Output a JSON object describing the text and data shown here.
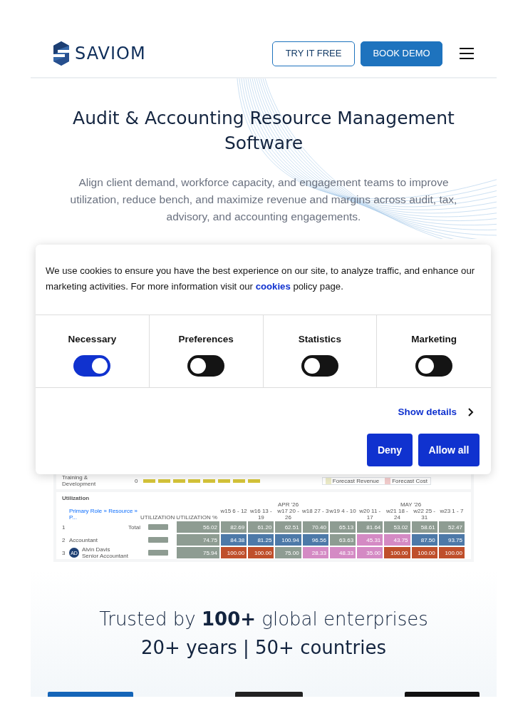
{
  "header": {
    "logo": "SAVIOM",
    "buttons": [
      {
        "label": "TRY IT FREE",
        "kind": "outline"
      },
      {
        "label": "BOOK DEMO",
        "kind": "solid"
      }
    ]
  },
  "hero": {
    "title": "Audit & Accounting Resource Management Software",
    "subtitle": "Align client demand, workforce capacity, and engagement teams to improve utilization, reduce bench, and maximize revenue and margins across audit, tax, advisory, and accounting engagements."
  },
  "cookie_dialog": {
    "text_before": "We use cookies to ensure you have the best experience on our site, to analyze traffic, and enhance our marketing activities. For more information visit our",
    "link": "cookies",
    "text_after": "policy page.",
    "categories": [
      {
        "label": "Necessary",
        "on": true
      },
      {
        "label": "Preferences",
        "on": false
      },
      {
        "label": "Statistics",
        "on": false
      },
      {
        "label": "Marketing",
        "on": false
      }
    ],
    "details_link": "Show details",
    "buttons": [
      "Deny",
      "Allow all"
    ]
  },
  "product_screenshot": {
    "top_panel": {
      "label": "Training & Development",
      "value": "0",
      "legend": [
        "Forecast Revenue",
        "Forecast Cost"
      ]
    },
    "utilization": {
      "title": "Utilization",
      "filter": "Primary Role » Resource » P...",
      "columns": [
        "UTILIZATION",
        "UTILIZATION %"
      ],
      "months": [
        "APR '26",
        "MAY '26"
      ],
      "weeks": [
        "w15 6 - 12",
        "w16 13 - 19",
        "w17 20 - 26",
        "w18 27 - 3",
        "w19 4 - 10",
        "w20 11 - 17",
        "w21 18 - 24",
        "w22 25 - 31",
        "w23 1 - 7"
      ],
      "rows": [
        {
          "index": "1",
          "label": "Total",
          "pct": "56.02",
          "cells": [
            {
              "value": "82.69",
              "color": "#8e9c92"
            },
            {
              "value": "61.20",
              "color": "#8e9c92"
            },
            {
              "value": "62.51",
              "color": "#8e9c92"
            },
            {
              "value": "70.40",
              "color": "#8e9c92"
            },
            {
              "value": "65.13",
              "color": "#8e9c92"
            },
            {
              "value": "81.64",
              "color": "#8e9c92"
            },
            {
              "value": "53.02",
              "color": "#8e9c92"
            },
            {
              "value": "58.61",
              "color": "#8e9c92"
            },
            {
              "value": "52.47",
              "color": "#8e9c92"
            }
          ]
        },
        {
          "index": "2",
          "label": "Accountant",
          "pct": "74.75",
          "cells": [
            {
              "value": "84.38",
              "color": "#4d79a8"
            },
            {
              "value": "81.25",
              "color": "#4d79a8"
            },
            {
              "value": "100.94",
              "color": "#4d79a8"
            },
            {
              "value": "96.56",
              "color": "#4d79a8"
            },
            {
              "value": "63.63",
              "color": "#8e9c92"
            },
            {
              "value": "45.31",
              "color": "#d48ac4"
            },
            {
              "value": "43.75",
              "color": "#d48ac4"
            },
            {
              "value": "87.50",
              "color": "#4d79a8"
            },
            {
              "value": "93.75",
              "color": "#4d79a8"
            }
          ]
        },
        {
          "index": "3",
          "label": "Alvin Davis",
          "sublabel": "Senior Accountant",
          "avatar": "AD",
          "pct": "75.94",
          "cells": [
            {
              "value": "100.00",
              "color": "#bf4f2b"
            },
            {
              "value": "100.00",
              "color": "#bf4f2b"
            },
            {
              "value": "75.00",
              "color": "#8e9c92"
            },
            {
              "value": "28.33",
              "color": "#d48ac4"
            },
            {
              "value": "48.33",
              "color": "#d48ac4"
            },
            {
              "value": "35.00",
              "color": "#d48ac4"
            },
            {
              "value": "100.00",
              "color": "#bf4f2b"
            },
            {
              "value": "100.00",
              "color": "#bf4f2b"
            },
            {
              "value": "100.00",
              "color": "#bf4f2b"
            }
          ]
        }
      ]
    }
  },
  "trust": {
    "line1": "Trusted by **100+** global enterprises",
    "line2": "20+ years | 50+ countries",
    "logos": [
      {
        "kind": "logo"
      },
      {
        "kind": "logo"
      },
      {
        "kind": "logo"
      }
    ]
  }
}
